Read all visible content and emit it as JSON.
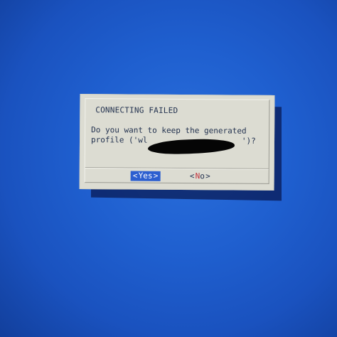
{
  "dialog": {
    "title": "CONNECTING FAILED",
    "message_line_1": "Do you want to keep the generated",
    "message_line_2": "profile ('wl                    ')?",
    "buttons": [
      {
        "left_chevron": "<",
        "hotkey": "Y",
        "rest": "es",
        "right_chevron": ">",
        "selected": true
      },
      {
        "left_chevron": "<",
        "hotkey": "N",
        "rest": "o",
        "right_chevron": ">",
        "selected": false
      }
    ]
  },
  "colors": {
    "desktop_blue": "#1f5fcf",
    "dialog_bg": "#dcdcd2",
    "selected_button_bg": "#2c5fd0",
    "hotkey_red": "#c2303a",
    "text_dark_blue": "#23324f"
  }
}
